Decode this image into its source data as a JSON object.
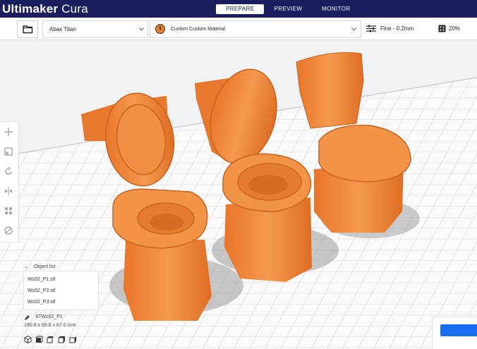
{
  "app": {
    "name_bold": "Ultimaker",
    "name_light": " Cura"
  },
  "stages": [
    "PREPARE",
    "PREVIEW",
    "MONITOR"
  ],
  "active_stage": "PREPARE",
  "toolbar": {
    "printer": "Abax Titan",
    "material_index": "1",
    "material": "Custom Custom Material",
    "profile": "Fine - 0.2mm",
    "infill": "20%"
  },
  "object_list": {
    "header": "Object list",
    "items": [
      "Wc02_P1.stl",
      "Wc02_P2.stl",
      "Wc02_P3.stl"
    ],
    "selected_name": "ATWc02_P1",
    "dimensions": "190.8 x 69.8 x 87.0 mm"
  },
  "colors": {
    "header": "#1a1d5e",
    "model": "#f08a3e",
    "accent": "#196ef0"
  },
  "icons": [
    "folder-icon",
    "chevron-down-icon",
    "settings-sliders-icon",
    "support-icon",
    "move-icon",
    "scale-icon",
    "rotate-icon",
    "mirror-icon",
    "per-model-settings-icon",
    "support-blocker-icon",
    "pencil-icon",
    "view-3d-icon",
    "view-front-icon",
    "view-top-icon",
    "view-left-icon",
    "view-right-icon"
  ]
}
